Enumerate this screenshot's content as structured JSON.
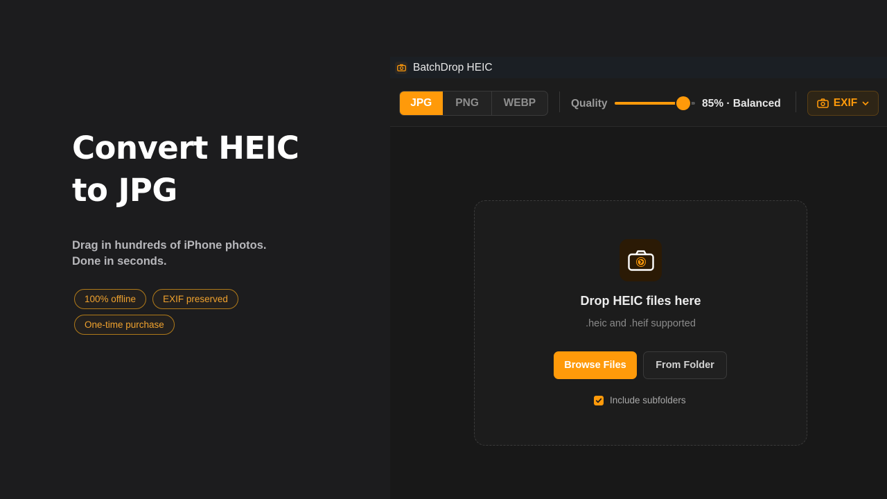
{
  "hero": {
    "title_line1": "Convert HEIC",
    "title_line2": "to JPG",
    "subtitle_line1": "Drag in hundreds of iPhone photos.",
    "subtitle_line2": "Done in seconds.",
    "badges": [
      "100% offline",
      "EXIF preserved",
      "One-time purchase"
    ]
  },
  "window": {
    "title": "BatchDrop HEIC",
    "icon": "camera-icon"
  },
  "toolbar": {
    "formats": [
      "JPG",
      "PNG",
      "WEBP"
    ],
    "selected_format": "JPG",
    "quality_label": "Quality",
    "quality_percent": 85,
    "quality_value_text": "85% · Balanced",
    "exif_label": "EXIF",
    "exif_icon": "camera-icon",
    "exif_dropdown_icon": "chevron-down-icon"
  },
  "dropzone": {
    "icon": "camera-icon",
    "title": "Drop HEIC files here",
    "subtitle": ".heic and .heif supported",
    "browse_label": "Browse Files",
    "folder_label": "From Folder",
    "subfolders_label": "Include subfolders",
    "subfolders_checked": true
  },
  "colors": {
    "accent": "#ff9a0a",
    "background": "#1c1c1e",
    "badge_text": "#f0a22e"
  }
}
